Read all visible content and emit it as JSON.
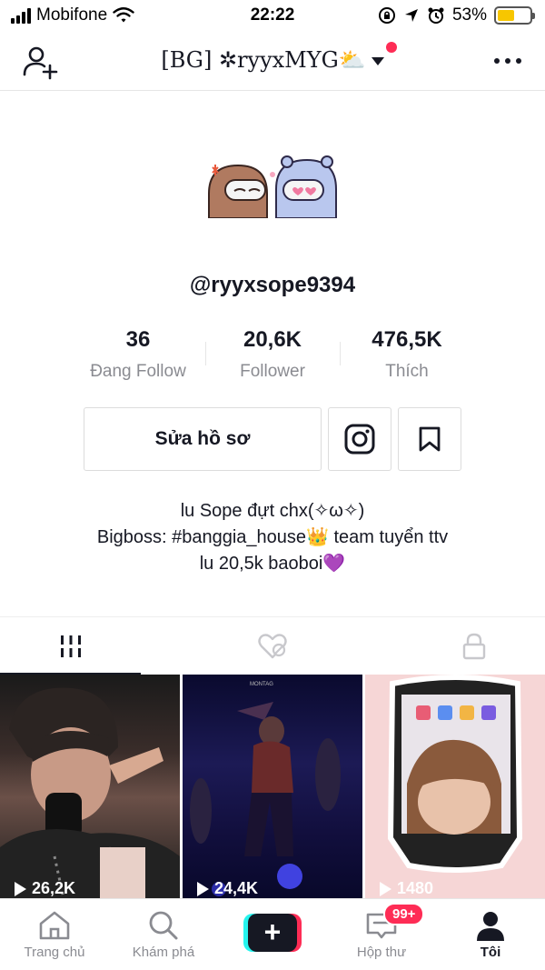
{
  "status_bar": {
    "carrier": "Mobifone",
    "time": "22:22",
    "battery": "53%",
    "battery_level": 0.53
  },
  "header": {
    "title": "[BG] ✲ryyxMYG⛅"
  },
  "profile": {
    "username": "@ryyxsope9394",
    "stats": [
      {
        "value": "36",
        "label": "Đang Follow"
      },
      {
        "value": "20,6K",
        "label": "Follower"
      },
      {
        "value": "476,5K",
        "label": "Thích"
      }
    ],
    "edit_button": "Sửa hồ sơ",
    "bio": [
      "lu Sope đựt chx(✧ω✧)",
      "Bigboss: #banggia_house👑 team tuyển ttv",
      "lu 20,5k baoboi💜"
    ]
  },
  "videos": [
    {
      "views": "26,2K"
    },
    {
      "views": "24,4K",
      "caption": "MONTAG"
    },
    {
      "views": "1480"
    }
  ],
  "bottom_nav": {
    "items": [
      {
        "label": "Trang chủ",
        "icon": "home-icon"
      },
      {
        "label": "Khám phá",
        "icon": "search-icon"
      },
      {
        "label": "",
        "icon": "plus-icon"
      },
      {
        "label": "Hộp thư",
        "icon": "inbox-icon",
        "badge": "99+"
      },
      {
        "label": "Tôi",
        "icon": "profile-icon"
      }
    ]
  },
  "colors": {
    "accent": "#fe2c55",
    "cyan": "#25f4ee",
    "text": "#161823",
    "muted": "#8a8b91"
  }
}
